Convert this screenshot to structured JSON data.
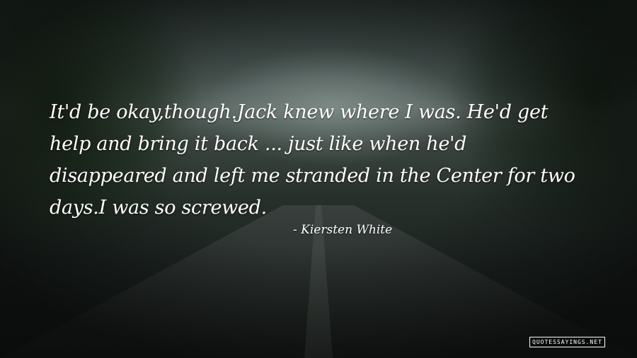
{
  "quote": {
    "text": "It'd be okay,though.Jack knew where I was. He'd get help and bring it back ... just like when he'd disappeared and left me stranded in the Center for two days.I was so screwed.",
    "lines": [
      "It'd be okay,though.Jack knew where I was. He'd get",
      "help and bring it back ... just like when he'd",
      "disappeared and left me stranded in the Center for two",
      "days.I was so screwed."
    ]
  },
  "author": "- Kiersten White",
  "watermark": "QUOTESSAYINGS.NET",
  "colors": {
    "text": "#ffffff",
    "background_top": "#2a3431",
    "background_bottom": "#161b19"
  }
}
